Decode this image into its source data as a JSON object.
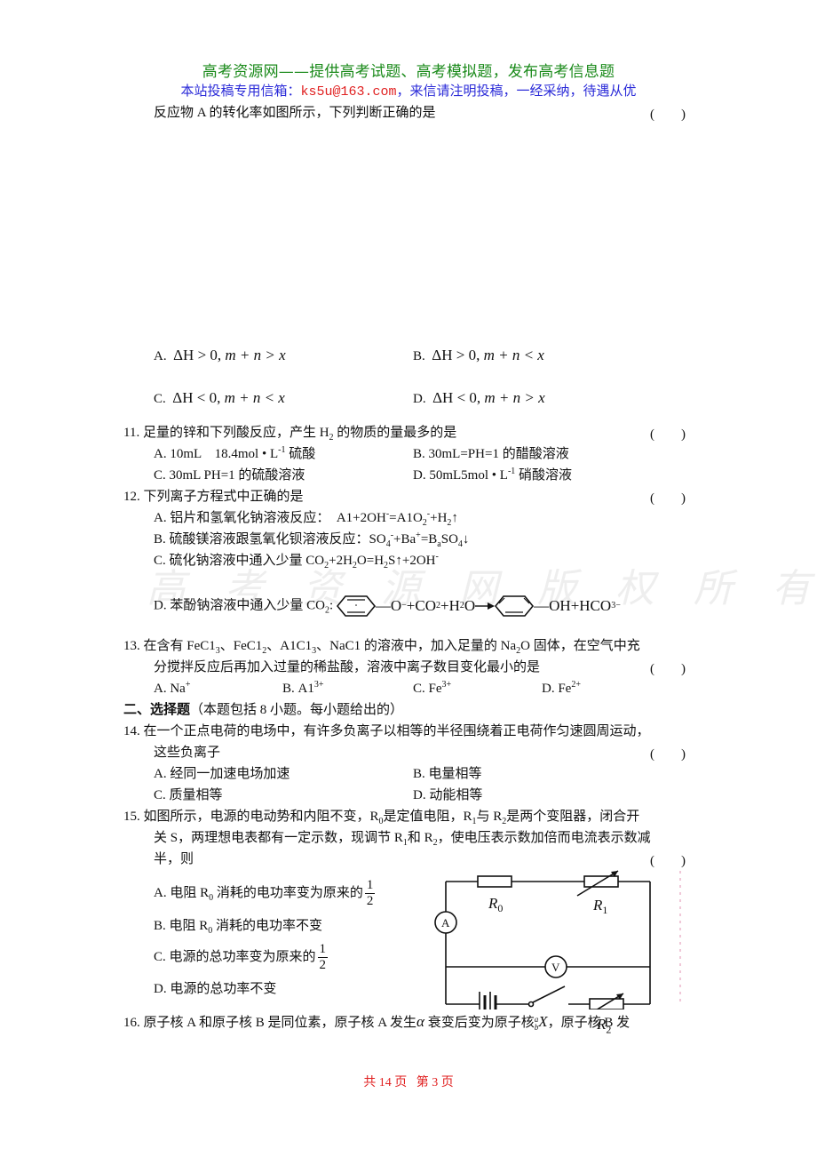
{
  "header": {
    "title": "高考资源网——提供高考试题、高考模拟题，发布高考信息题",
    "contact_prefix": "本站投稿专用信箱：",
    "contact_email": "ks5u@163.com",
    "contact_suffix": "，来信请注明投稿，一经采纳，待遇从优"
  },
  "watermark": "高考资源网版权所有",
  "q10": {
    "stem_tail": "反应物 A 的转化率如图所示，下列判断正确的是",
    "paren": "(　　)",
    "options": [
      {
        "label": "A.",
        "dh": "ΔH",
        "rel1": " > 0, ",
        "expr": "m + n > x"
      },
      {
        "label": "B.",
        "dh": "ΔH",
        "rel1": " > 0, ",
        "expr": "m + n < x"
      },
      {
        "label": "C.",
        "dh": "ΔH",
        "rel1": " < 0, ",
        "expr": "m + n < x"
      },
      {
        "label": "D.",
        "dh": "ΔH",
        "rel1": " < 0, ",
        "expr": "m + n > x"
      }
    ]
  },
  "q11": {
    "number": "11.",
    "stem_a": "足量的锌和下列酸反应，产生 H",
    "stem_sub": "2",
    "stem_b": " 的物质的量最多的是",
    "paren": "(　　)",
    "options": [
      {
        "label": "A.",
        "pre": "10mL　18.4mol • L",
        "sup": "-1",
        "post": " 硫酸"
      },
      {
        "label": "B.",
        "pre": "30mL=PH=1 的醋酸溶液",
        "sup": "",
        "post": ""
      },
      {
        "label": "C.",
        "pre": "30mL PH=1 的硫酸溶液",
        "sup": "",
        "post": ""
      },
      {
        "label": "D.",
        "pre": "50mL5mol • L",
        "sup": "-1",
        "post": " 硝酸溶液"
      }
    ]
  },
  "q12": {
    "number": "12.",
    "stem": "下列离子方程式中正确的是",
    "paren": "(　　)",
    "optA": {
      "label": "A.",
      "text": "铝片和氢氧化钠溶液反应：　A1+2OH",
      "sup1": "-",
      "mid": "=A1O",
      "sub": "2",
      "sup2": "-",
      "end": "+H",
      "sub2": "2",
      "arrow": "↑"
    },
    "optB": {
      "label": "B.",
      "text": "硫酸镁溶液跟氢氧化钡溶液反应：SO",
      "sub": "4",
      "sup1": "-",
      "mid": "+Ba",
      "sup2": "+",
      "end": "=B",
      "sub2": "a",
      "tail": "SO",
      "sub3": "4",
      "arrow": "↓"
    },
    "optC": {
      "label": "C.",
      "text": "硫化钠溶液中通入少量 CO",
      "sub": "2",
      "mid": "+2H",
      "sub2": "2",
      "mid2": "O=H",
      "sub3": "2",
      "end": "S↑+2OH",
      "sup": "-"
    },
    "optD": {
      "label": "D.",
      "text": "苯酚钠溶液中通入少量 CO",
      "sub": "2",
      "colon": ":",
      "eq_left": "—O",
      "eq_left_sup": "−",
      "eq_plus1": "+CO",
      "eq_sub1": "2",
      "eq_plus2": "+H",
      "eq_sub2": "2",
      "eq_o": "O",
      "eq_right": "—OH+HCO",
      "eq_sub3": "3",
      "eq_sup3": "−"
    }
  },
  "q13": {
    "number": "13.",
    "line1": [
      "在含有 FeC1",
      "3",
      "、FeC1",
      "2",
      "、A1C1",
      "3",
      "、NaC1 的溶液中，加入足量的 Na",
      "2",
      "O 固体，在空气中充"
    ],
    "line2": "分搅拌反应后再加入过量的稀盐酸，溶液中离子数目变化最小的是",
    "paren": "(　　)",
    "options": [
      {
        "label": "A.",
        "base": "Na",
        "sup": "+"
      },
      {
        "label": "B.",
        "base": "A1",
        "sup": "3+"
      },
      {
        "label": "C.",
        "base": "Fe",
        "sup": "3+"
      },
      {
        "label": "D.",
        "base": "Fe",
        "sup": "2+"
      }
    ]
  },
  "section2": {
    "title": "二、选择题",
    "note": "（本题包括 8 小题。每小题给出的）"
  },
  "q14": {
    "number": "14.",
    "line1": "在一个正点电荷的电场中，有许多负离子以相等的半径围绕着正电荷作匀速圆周运动，",
    "line2": "这些负离子",
    "paren": "(　　)",
    "options": [
      {
        "label": "A.",
        "text": "经同一加速电场加速"
      },
      {
        "label": "B.",
        "text": "电量相等"
      },
      {
        "label": "C.",
        "text": "质量相等"
      },
      {
        "label": "D.",
        "text": "动能相等"
      }
    ]
  },
  "q15": {
    "number": "15.",
    "line1": [
      "如图所示，电源的电动势和内阻不变，R",
      "0",
      "是定值电阻，R",
      "1",
      "与 R",
      "2",
      "是两个变阻器，闭合开"
    ],
    "line2": [
      "关 S，两理想电表都有一定示数，现调节 R",
      "1",
      "和 R",
      "2",
      "，使电压表示数加倍而电流表示数减"
    ],
    "line3": "半，则",
    "paren": "(　　)",
    "options": [
      {
        "label": "A.",
        "text": "电阻 R",
        "sub": "0",
        "text2": " 消耗的电功率变为原来的",
        "frac": [
          "1",
          "2"
        ]
      },
      {
        "label": "B.",
        "text": "电阻 R",
        "sub": "0",
        "text2": " 消耗的电功率不变",
        "frac": null
      },
      {
        "label": "C.",
        "text": "电源的总功率变为原来的",
        "sub": "",
        "text2": "",
        "frac": [
          "1",
          "2"
        ]
      },
      {
        "label": "D.",
        "text": "电源的总功率不变",
        "sub": "",
        "text2": "",
        "frac": null
      }
    ],
    "circuit": {
      "r0": "R",
      "r0_sub": "0",
      "r1": "R",
      "r1_sub": "1",
      "r2": "R",
      "r2_sub": "2",
      "switch": "S",
      "ammeter": "A",
      "voltmeter": "V"
    }
  },
  "q16": {
    "number": "16.",
    "text_a": "原子核 A 和原子核 B 是同位素，原子核 A 发生",
    "alpha": "α",
    "text_b": " 衰变后变为原子核",
    "iso_a": "a",
    "iso_b": "b",
    "iso_x": "X",
    "text_c": "，原子核 B 发"
  },
  "footer": {
    "total": "共 14 页",
    "current": "第 3 页"
  }
}
